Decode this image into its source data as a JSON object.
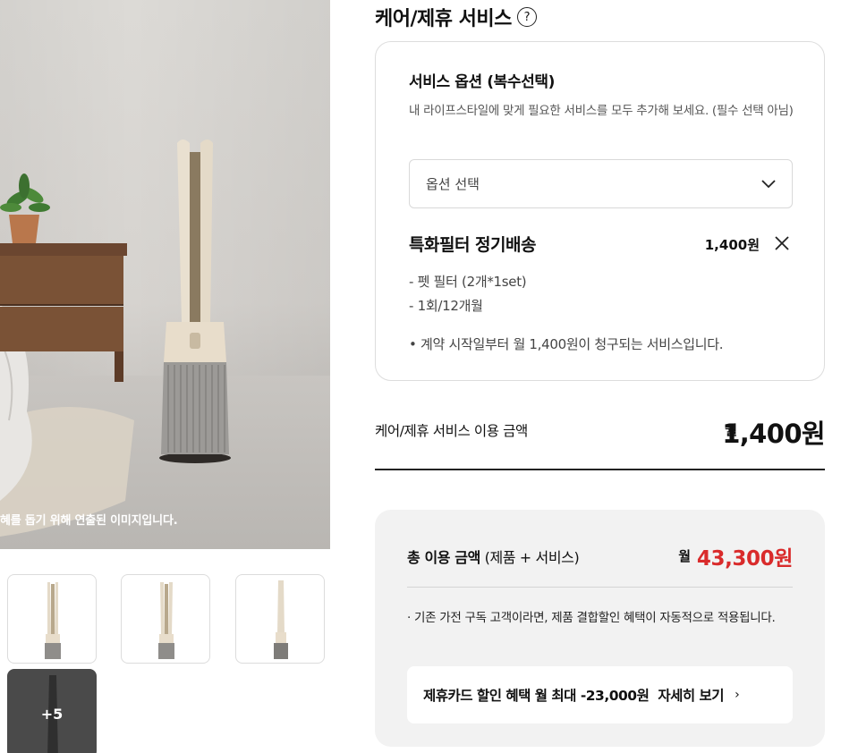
{
  "gallery": {
    "caption": "혜를 돕기 위해 연출된 이미지입니다.",
    "more_count": "+5",
    "thumbnails": [
      "product-front-icon",
      "product-front-icon",
      "product-side-icon",
      "product-dark-icon"
    ]
  },
  "care": {
    "title": "케어/제휴 서비스",
    "help_icon": "question-circle-icon",
    "help_symbol": "?",
    "options": {
      "title": "서비스 옵션 (복수선택)",
      "description": "내 라이프스타일에 맞게 필요한 서비스를 모두 추가해 보세요. (필수 선택 아님)",
      "select_placeholder": "옵션 선택"
    },
    "selected_service": {
      "name": "특화필터 정기배송",
      "price": "1,400원",
      "details": [
        "- 펫 필터 (2개*1set)",
        "- 1회/12개월"
      ],
      "note": "• 계약 시작일부터 월 1,400원이 청구되는 서비스입니다."
    },
    "amount": {
      "label": "케어/제휴 서비스 이용 금액",
      "month": "월",
      "value": "1,400원"
    }
  },
  "total": {
    "label_bold": "총 이용 금액",
    "label_rest": " (제품 + 서비스)",
    "month": "월",
    "value": "43,300원",
    "note": "· 기존 가전 구독 고객이라면, 제품 결합할인 혜택이 자동적으로 적용됩니다.",
    "promo": {
      "text": "제휴카드 할인 혜택 월 최대 -23,000원",
      "detail": "자세히 보기",
      "chevron": "›"
    }
  },
  "colors": {
    "accent_red": "#d92b2b",
    "panel_gray": "#f2f2f2",
    "border": "#dddddd"
  }
}
